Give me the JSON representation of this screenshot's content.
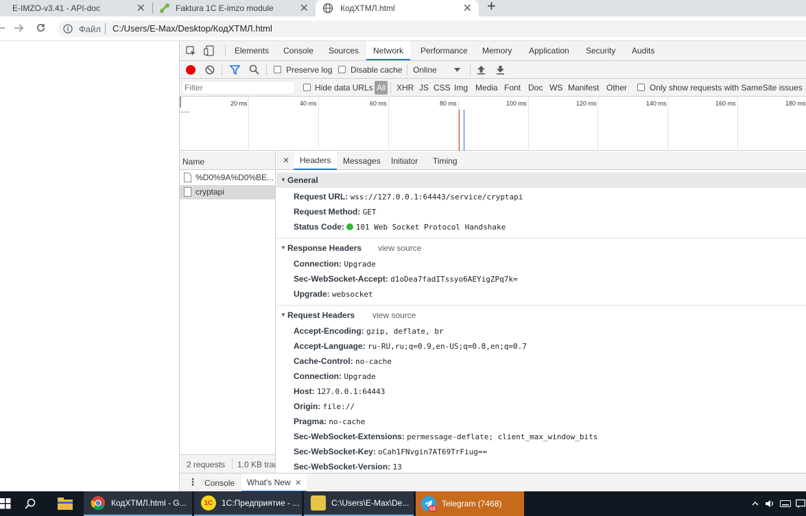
{
  "browser": {
    "tabs": [
      {
        "title": "E-IMZO-v3.41 - API-doc"
      },
      {
        "title": "Faktura 1C E-imzo module"
      },
      {
        "title": "КодХТМЛ.html"
      }
    ],
    "new_tab_symbol": "+",
    "close_symbol": "✕",
    "address": {
      "scheme_label": "Файл",
      "url": "C:/Users/E-Max/Desktop/КодХТМЛ.html"
    }
  },
  "devtools": {
    "main_tabs": [
      "Elements",
      "Console",
      "Sources",
      "Network",
      "Performance",
      "Memory",
      "Application",
      "Security",
      "Audits"
    ],
    "active_main_tab": "Network",
    "toolbar": {
      "preserve_log": "Preserve log",
      "disable_cache": "Disable cache",
      "throttle": "Online"
    },
    "filterbar": {
      "placeholder": "Filter",
      "hide_data_urls": "Hide data URLs",
      "types": [
        "All",
        "XHR",
        "JS",
        "CSS",
        "Img",
        "Media",
        "Font",
        "Doc",
        "WS",
        "Manifest",
        "Other"
      ],
      "samesite": "Only show requests with SameSite issues"
    },
    "timeline_ticks": [
      "20 ms",
      "40 ms",
      "60 ms",
      "80 ms",
      "100 ms",
      "120 ms",
      "140 ms",
      "160 ms",
      "180 ms"
    ],
    "requests": {
      "column_name": "Name",
      "items": [
        "%D0%9A%D0%BE...",
        "cryptapi"
      ],
      "summary": "2 requests",
      "transferred": "1.0 KB trar"
    },
    "detail_tabs": [
      "Headers",
      "Messages",
      "Initiator",
      "Timing"
    ],
    "general": {
      "title": "General",
      "rows": [
        {
          "name": "Request URL:",
          "value": "wss://127.0.0.1:64443/service/cryptapi"
        },
        {
          "name": "Request Method:",
          "value": "GET"
        },
        {
          "name": "Status Code:",
          "value": "101 Web Socket Protocol Handshake"
        }
      ]
    },
    "response_headers": {
      "title": "Response Headers",
      "view_source": "view source",
      "rows": [
        {
          "name": "Connection:",
          "value": "Upgrade"
        },
        {
          "name": "Sec-WebSocket-Accept:",
          "value": "d1oDea7fadITssyo6AEYigZPq7k="
        },
        {
          "name": "Upgrade:",
          "value": "websocket"
        }
      ]
    },
    "request_headers": {
      "title": "Request Headers",
      "view_source": "view source",
      "rows": [
        {
          "name": "Accept-Encoding:",
          "value": "gzip, deflate, br"
        },
        {
          "name": "Accept-Language:",
          "value": "ru-RU,ru;q=0.9,en-US;q=0.8,en;q=0.7"
        },
        {
          "name": "Cache-Control:",
          "value": "no-cache"
        },
        {
          "name": "Connection:",
          "value": "Upgrade"
        },
        {
          "name": "Host:",
          "value": "127.0.0.1:64443"
        },
        {
          "name": "Origin:",
          "value": "file://"
        },
        {
          "name": "Pragma:",
          "value": "no-cache"
        },
        {
          "name": "Sec-WebSocket-Extensions:",
          "value": "permessage-deflate; client_max_window_bits"
        },
        {
          "name": "Sec-WebSocket-Key:",
          "value": "oCah1FNvgin7AT69TrFiug=="
        },
        {
          "name": "Sec-WebSocket-Version:",
          "value": "13"
        }
      ]
    },
    "drawer": {
      "tabs": [
        "Console",
        "What's New"
      ],
      "close_symbol": "✕"
    }
  },
  "taskbar": {
    "items": [
      {
        "label": "КодХТМЛ.html - G..."
      },
      {
        "label": "1С:Предприятие - ..."
      },
      {
        "label": "C:\\Users\\E-Max\\De..."
      },
      {
        "label": "Telegram (7468)"
      }
    ],
    "telegram_badge": "68"
  },
  "colors": {
    "accent": "#1a73e8",
    "status_ok": "#36b535",
    "record": "#e8000b",
    "taskbar": "#101822"
  }
}
